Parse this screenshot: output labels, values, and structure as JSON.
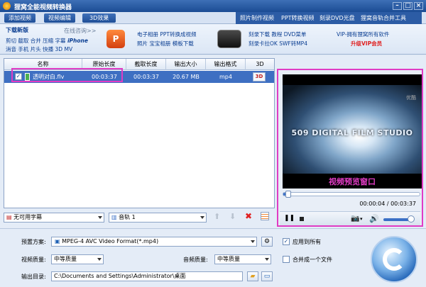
{
  "window": {
    "title": "狸窝全能视频转换器"
  },
  "menu": {
    "add_video": "添加视频",
    "video_edit": "视频编辑",
    "effects_3d": "3D效果",
    "links": [
      "照片制作视频",
      "PPT转换视频",
      "刻录DVD光盘",
      "狸窝音轨合并工具"
    ]
  },
  "banner": {
    "download_new": "下载新版",
    "online_help": "在线咨询>>",
    "tools_line1": "剪切 截取 合并 压缩 字幕",
    "iphone": "iPhone",
    "tools_line2": "消音 手机 片头 快播 3D MV",
    "promo1_line1": "电子相册 PPT转换成视频",
    "promo1_line2": "照片 宝宝相册 模板下载",
    "promo2_line1": "刻录下载 教程 DVD菜单",
    "promo2_line2": "刻录卡拉OK SWF转MP4",
    "vip_line1": "VIP-拥有狸窝所有软件",
    "vip_line2": "升级VIP会员"
  },
  "table": {
    "headers": [
      "名称",
      "原始长度",
      "截取长度",
      "输出大小",
      "输出格式",
      "3D"
    ],
    "rows": [
      {
        "name": "透明对白.flv",
        "original_length": "00:03:37",
        "clip_length": "00:03:37",
        "output_size": "20.67 MB",
        "format": "mp4",
        "checked": true
      }
    ]
  },
  "preview": {
    "watermark": "优酷",
    "studio_text": "509 DIGITAL FILM STUDIO",
    "caption": "视频预览窗口",
    "time": "00:00:04 / 00:03:37",
    "progress": 0.018,
    "volume": 0.85
  },
  "subtitle_bar": {
    "subtitle_select": "无可用字幕",
    "audio_select": "音轨 1"
  },
  "settings": {
    "preset_label": "预置方案:",
    "preset_value": "MPEG-4 AVC Video Format(*.mp4)",
    "apply_all": "应用到所有",
    "video_quality_label": "视频质量:",
    "video_quality_value": "中等质量",
    "audio_quality_label": "音频质量:",
    "audio_quality_value": "中等质量",
    "merge_label": "合并成一个文件",
    "output_label": "输出目录:",
    "output_path": "C:\\Documents and Settings\\Administrator\\桌面"
  },
  "colors": {
    "highlight": "#e03cc4",
    "accent": "#3e6fc2",
    "title_bar": "#1b4c94"
  }
}
